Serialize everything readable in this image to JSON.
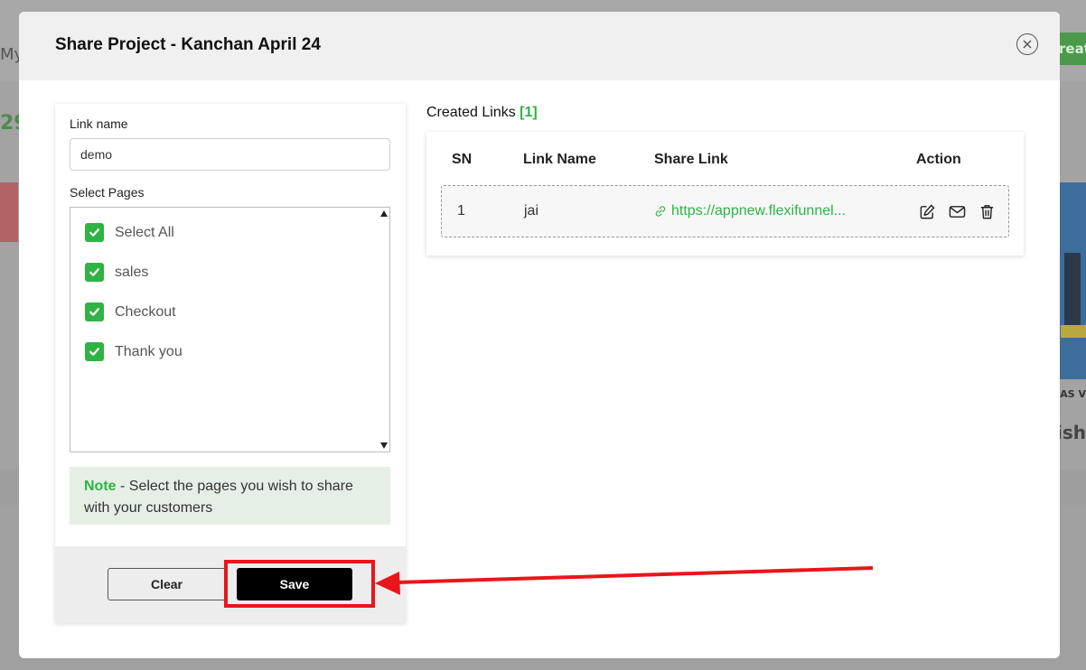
{
  "background": {
    "my_text": "My",
    "number_text": "29",
    "create_text": "reat",
    "as_text": "AS V",
    "ish_text": "ish"
  },
  "modal": {
    "title": "Share Project - Kanchan April 24",
    "close_icon": "close-circle-icon"
  },
  "form": {
    "link_name_label": "Link name",
    "link_name_value": "demo",
    "select_pages_label": "Select Pages",
    "pages": [
      {
        "label": "Select All",
        "checked": true
      },
      {
        "label": "sales",
        "checked": true
      },
      {
        "label": "Checkout",
        "checked": true
      },
      {
        "label": "Thank you",
        "checked": true
      }
    ],
    "note_strong": "Note",
    "note_text": " - Select the pages you wish to share with your customers",
    "clear_label": "Clear",
    "save_label": "Save"
  },
  "links": {
    "title": "Created Links ",
    "count": "[1]",
    "columns": [
      "SN",
      "Link Name",
      "Share Link",
      "Action"
    ],
    "rows": [
      {
        "sn": "1",
        "name": "jai",
        "url": "https://appnew.flexifunnel..."
      }
    ],
    "action_icons": [
      "edit-icon",
      "mail-icon",
      "trash-icon"
    ]
  },
  "colors": {
    "accent": "#2fb344",
    "annotation": "#e8161b"
  }
}
